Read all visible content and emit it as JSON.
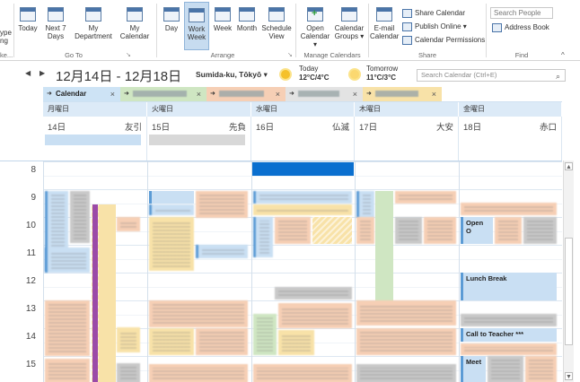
{
  "ribbon": {
    "cut_left_1": "ype",
    "cut_left_2": "ng",
    "cut_left_3": "ke...",
    "goto": {
      "today": "Today",
      "next7_l1": "Next 7",
      "next7_l2": "Days",
      "label": "Go To"
    },
    "mydept": {
      "l1": "My",
      "l2": "Department"
    },
    "mycal": {
      "l1": "My",
      "l2": "Calendar"
    },
    "arrange": {
      "day": "Day",
      "workweek_l1": "Work",
      "workweek_l2": "Week",
      "week": "Week",
      "month": "Month",
      "schedule_l1": "Schedule",
      "schedule_l2": "View",
      "label": "Arrange"
    },
    "manage": {
      "open_l1": "Open",
      "open_l2": "Calendar ▾",
      "groups_l1": "Calendar",
      "groups_l2": "Groups ▾",
      "label": "Manage Calendars"
    },
    "share": {
      "email_l1": "E-mail",
      "email_l2": "Calendar",
      "share_calendar": "Share Calendar",
      "publish_online": "Publish Online ▾",
      "calendar_permissions": "Calendar Permissions",
      "label": "Share"
    },
    "find": {
      "search_people": "Search People",
      "address_book": "Address Book",
      "label": "Find"
    },
    "collapse": "^",
    "launcher": "↘"
  },
  "navbar": {
    "prev": "◀",
    "next": "▶",
    "date_range": "12月14日 - 12月18日",
    "location": "Sumida-ku, Tōkyō ▾",
    "today_label": "Today",
    "today_temp": "12°C/4°C",
    "tomorrow_label": "Tomorrow",
    "tomorrow_temp": "11°C/3°C",
    "search_placeholder": "Search Calendar (Ctrl+E)",
    "search_icon": "⌕"
  },
  "tabs": [
    {
      "label": "Calendar",
      "close": "×",
      "color": "#cde3f5"
    },
    {
      "label": "",
      "close": "×",
      "color": "#cfe6c2"
    },
    {
      "label": "",
      "close": "×",
      "color": "#f6cfb5"
    },
    {
      "label": "",
      "close": "×",
      "color": "#e3e3e3"
    },
    {
      "label": "",
      "close": "×",
      "color": "#f8e2a8"
    }
  ],
  "days": [
    {
      "dow": "月曜日",
      "num": "14日",
      "rokuyo": "友引"
    },
    {
      "dow": "火曜日",
      "num": "15日",
      "rokuyo": "先負"
    },
    {
      "dow": "水曜日",
      "num": "16日",
      "rokuyo": "仏滅"
    },
    {
      "dow": "木曜日",
      "num": "17日",
      "rokuyo": "大安"
    },
    {
      "dow": "金曜日",
      "num": "18日",
      "rokuyo": "赤口"
    }
  ],
  "hours": [
    "8",
    "9",
    "10",
    "11",
    "12",
    "13",
    "14",
    "15"
  ],
  "events": {
    "open": "Open O",
    "lunch": "Lunch Break",
    "call_teacher": "Call to Teacher ***",
    "meet": "Meet"
  },
  "colors": {
    "accent": "#0a6fcf",
    "header_bg": "#dceaf7",
    "event_blue": "#c9dff3",
    "event_orange": "#f6cfb5",
    "event_yellow": "#f8e2a8",
    "event_green": "#cfe6c2",
    "event_purple": "#9b4aa8"
  }
}
